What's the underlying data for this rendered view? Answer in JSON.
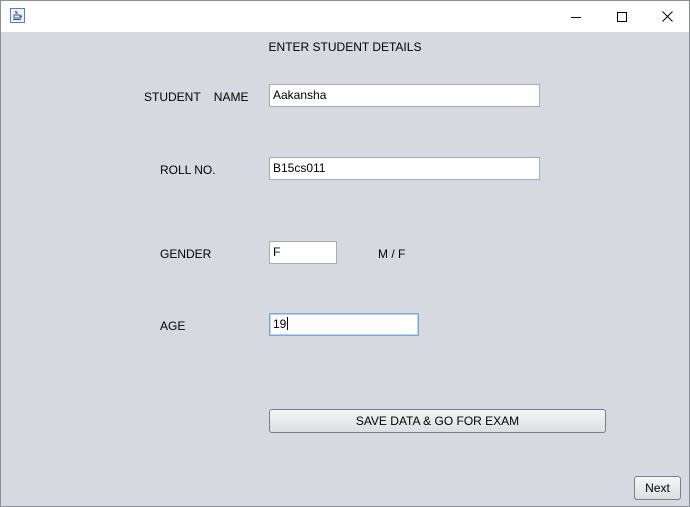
{
  "window": {
    "controls": {
      "minimize_icon": "minimize-icon",
      "maximize_icon": "maximize-icon",
      "close_icon": "close-icon"
    }
  },
  "form": {
    "heading": "ENTER STUDENT DETAILS",
    "name_label": "STUDENT    NAME",
    "name_value": "Aakansha",
    "roll_label": "ROLL NO.",
    "roll_value": "B15cs011",
    "gender_label": "GENDER",
    "gender_value": "F",
    "gender_hint": "M / F",
    "age_label": "AGE",
    "age_value": "19",
    "save_button": "SAVE DATA & GO FOR EXAM",
    "next_button": "Next"
  }
}
